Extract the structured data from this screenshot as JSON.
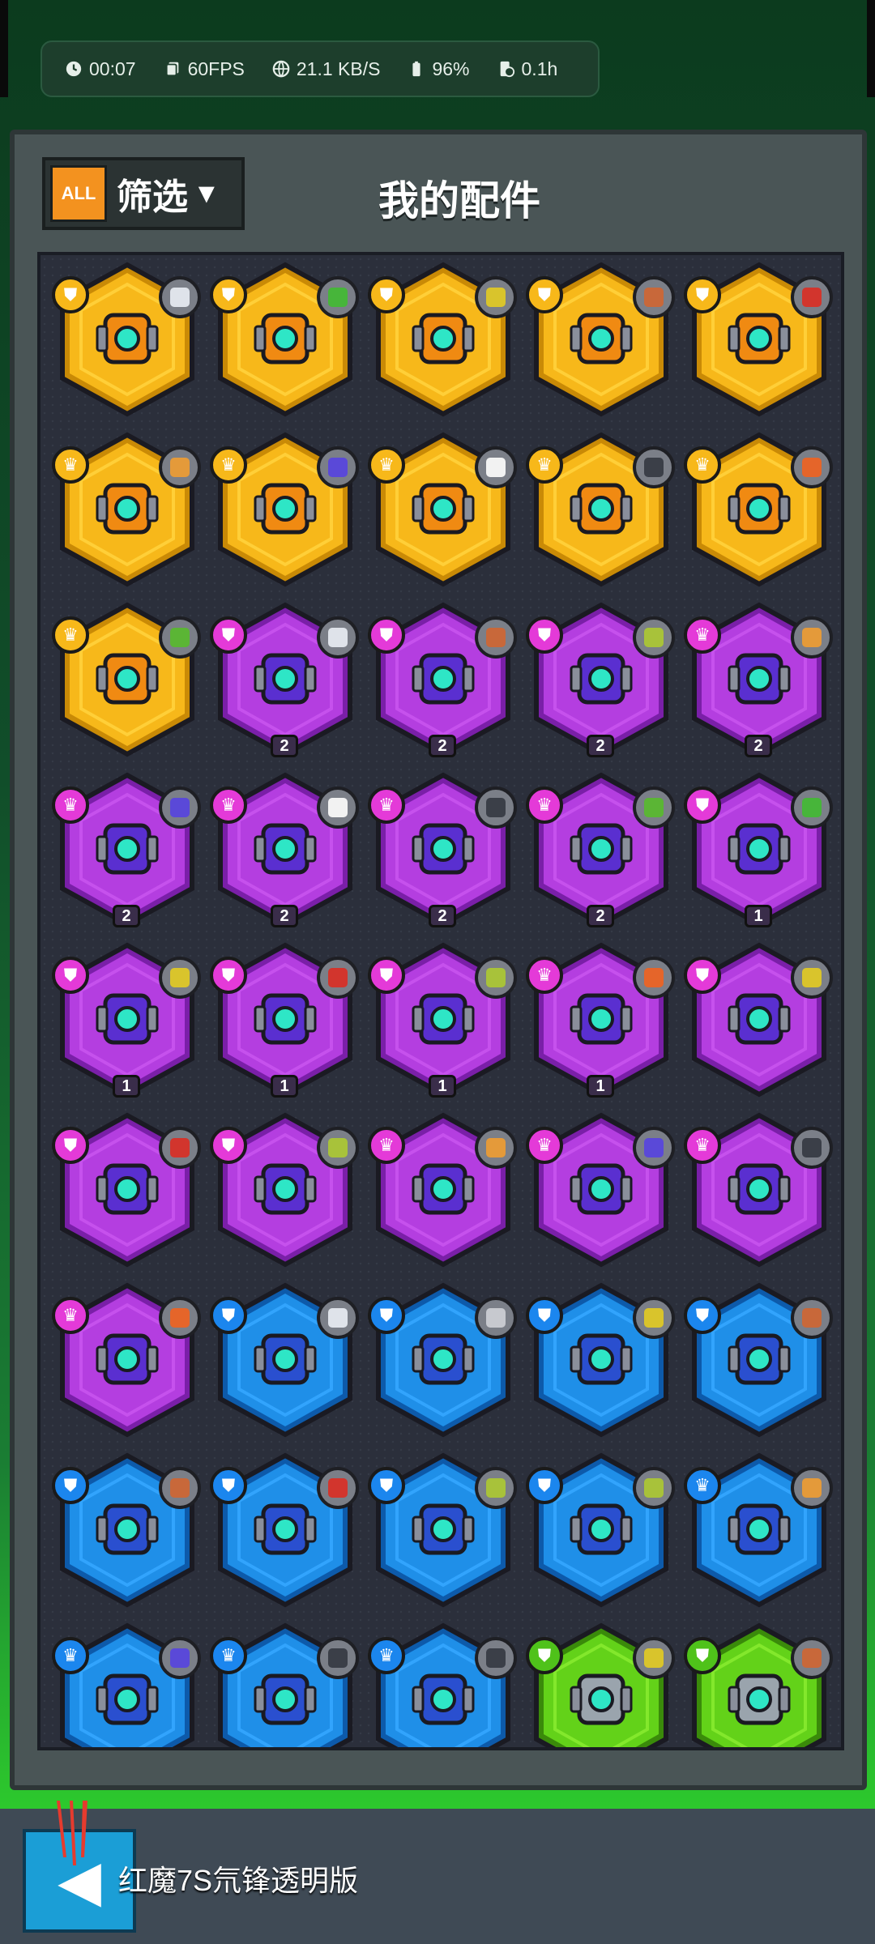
{
  "status_bar": {
    "time": "00:07",
    "fps": "60FPS",
    "network": "21.1 KB/S",
    "battery": "96%",
    "duration": "0.1h"
  },
  "header": {
    "all_badge": "ALL",
    "filter_label": "筛选",
    "filter_arrow": "▼",
    "title": "我的配件"
  },
  "colors": {
    "gold_fill": "#f7b81a",
    "purple_fill": "#b43ee0",
    "blue_fill": "#1f8fe8",
    "green_fill": "#63d219"
  },
  "items": [
    {
      "tier": "gold",
      "rarity": "shield",
      "part": "rocket",
      "level": ""
    },
    {
      "tier": "gold",
      "rarity": "shield",
      "part": "green-ball",
      "level": ""
    },
    {
      "tier": "gold",
      "rarity": "shield",
      "part": "target",
      "level": ""
    },
    {
      "tier": "gold",
      "rarity": "shield",
      "part": "brick",
      "level": ""
    },
    {
      "tier": "gold",
      "rarity": "shield",
      "part": "red-arc",
      "level": ""
    },
    {
      "tier": "gold",
      "rarity": "crown",
      "part": "shell",
      "level": ""
    },
    {
      "tier": "gold",
      "rarity": "crown",
      "part": "cone",
      "level": ""
    },
    {
      "tier": "gold",
      "rarity": "crown",
      "part": "soccer-ball",
      "level": ""
    },
    {
      "tier": "gold",
      "rarity": "crown",
      "part": "cannon",
      "level": ""
    },
    {
      "tier": "gold",
      "rarity": "crown",
      "part": "orange-claw",
      "level": ""
    },
    {
      "tier": "gold",
      "rarity": "crown",
      "part": "bottle",
      "level": ""
    },
    {
      "tier": "purple",
      "rarity": "shield",
      "part": "rocket",
      "level": "2"
    },
    {
      "tier": "purple",
      "rarity": "shield",
      "part": "brick",
      "level": "2"
    },
    {
      "tier": "purple",
      "rarity": "shield",
      "part": "spiky-ball",
      "level": "2"
    },
    {
      "tier": "purple",
      "rarity": "crown",
      "part": "shell",
      "level": "2"
    },
    {
      "tier": "purple",
      "rarity": "crown",
      "part": "cone",
      "level": "2"
    },
    {
      "tier": "purple",
      "rarity": "crown",
      "part": "soccer-ball",
      "level": "2"
    },
    {
      "tier": "purple",
      "rarity": "crown",
      "part": "cannon",
      "level": "2"
    },
    {
      "tier": "purple",
      "rarity": "crown",
      "part": "bottle",
      "level": "2"
    },
    {
      "tier": "purple",
      "rarity": "shield",
      "part": "green-ball",
      "level": "1"
    },
    {
      "tier": "purple",
      "rarity": "shield",
      "part": "target",
      "level": "1"
    },
    {
      "tier": "purple",
      "rarity": "shield",
      "part": "red-arc",
      "level": "1"
    },
    {
      "tier": "purple",
      "rarity": "shield",
      "part": "spiky-ball",
      "level": "1"
    },
    {
      "tier": "purple",
      "rarity": "crown",
      "part": "orange-claw",
      "level": "1"
    },
    {
      "tier": "purple",
      "rarity": "shield",
      "part": "target",
      "level": ""
    },
    {
      "tier": "purple",
      "rarity": "shield",
      "part": "red-arc",
      "level": ""
    },
    {
      "tier": "purple",
      "rarity": "shield",
      "part": "spiky-ball",
      "level": ""
    },
    {
      "tier": "purple",
      "rarity": "crown",
      "part": "shell",
      "level": ""
    },
    {
      "tier": "purple",
      "rarity": "crown",
      "part": "cone",
      "level": ""
    },
    {
      "tier": "purple",
      "rarity": "crown",
      "part": "cannon",
      "level": ""
    },
    {
      "tier": "purple",
      "rarity": "crown",
      "part": "orange-claw",
      "level": ""
    },
    {
      "tier": "blue",
      "rarity": "shield",
      "part": "rocket",
      "level": ""
    },
    {
      "tier": "blue",
      "rarity": "shield",
      "part": "grey-ball",
      "level": ""
    },
    {
      "tier": "blue",
      "rarity": "shield",
      "part": "target",
      "level": ""
    },
    {
      "tier": "blue",
      "rarity": "shield",
      "part": "brick",
      "level": ""
    },
    {
      "tier": "blue",
      "rarity": "shield",
      "part": "brick",
      "level": ""
    },
    {
      "tier": "blue",
      "rarity": "shield",
      "part": "red-arc",
      "level": ""
    },
    {
      "tier": "blue",
      "rarity": "shield",
      "part": "spiky-ball",
      "level": ""
    },
    {
      "tier": "blue",
      "rarity": "shield",
      "part": "spiky-ball",
      "level": ""
    },
    {
      "tier": "blue",
      "rarity": "crown",
      "part": "shell",
      "level": ""
    },
    {
      "tier": "blue",
      "rarity": "crown",
      "part": "cone",
      "level": ""
    },
    {
      "tier": "blue",
      "rarity": "crown",
      "part": "cannon",
      "level": ""
    },
    {
      "tier": "blue",
      "rarity": "crown",
      "part": "cannon",
      "level": ""
    },
    {
      "tier": "green",
      "rarity": "shield",
      "part": "target",
      "level": ""
    },
    {
      "tier": "green",
      "rarity": "shield",
      "part": "brick",
      "level": ""
    }
  ],
  "bottom_bar": {
    "back_arrow": "◀",
    "caption": "红魔7S氘锋透明版"
  }
}
